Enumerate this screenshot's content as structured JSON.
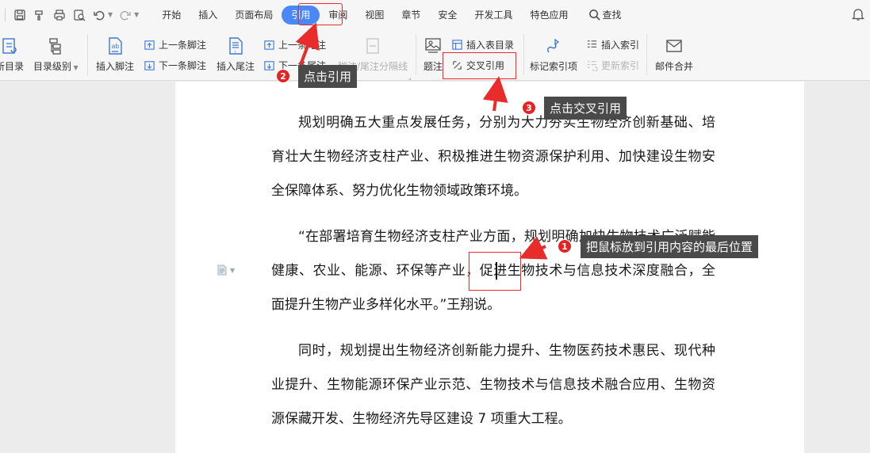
{
  "menubar": {
    "tabs": [
      {
        "label": "开始",
        "active": false
      },
      {
        "label": "插入",
        "active": false
      },
      {
        "label": "页面布局",
        "active": false
      },
      {
        "label": "引用",
        "active": true
      },
      {
        "label": "审阅",
        "active": false
      },
      {
        "label": "视图",
        "active": false
      },
      {
        "label": "章节",
        "active": false
      },
      {
        "label": "安全",
        "active": false
      },
      {
        "label": "开发工具",
        "active": false
      },
      {
        "label": "特色应用",
        "active": false
      }
    ],
    "search_label": "查找",
    "accent_color": "#4a89f5"
  },
  "ribbon": {
    "update_toc": "新目录",
    "toc_level": "目录级别",
    "insert_footnote": "插入脚注",
    "prev_footnote": "上一条脚注",
    "next_footnote": "下一条脚注",
    "insert_endnote": "插入尾注",
    "prev_endnote": "上一条尾注",
    "next_endnote": "下一条尾注",
    "separator": "脚注/尾注分隔线",
    "caption": "题注",
    "insert_table_of_figures": "插入表目录",
    "cross_reference": "交叉引用",
    "mark_index": "标记索引项",
    "insert_index": "插入索引",
    "update_index": "更新索引",
    "mail_merge": "邮件合并"
  },
  "document": {
    "paragraphs": [
      "规划明确五大重点发展任务，分别为大力夯实生物经济创新基础、培育壮大生物经济支柱产业、积极推进生物资源保护利用、加快建设生物安全保障体系、努力优化生物领域政策环境。",
      "“在部署培育生物经济支柱产业方面，规划明确加快生物技术广泛赋能健康、农业、能源、环保等产业，促进生物技术与信息技术深度融合，全面提升生物产业多样化水平。”王翔说。",
      "同时，规划提出生物经济创新能力提升、生物医药技术惠民、现代种业提升、生物能源环保产业示范、生物技术与信息技术融合应用、生物资源保藏开发、生物经济先导区建设 7 项重大工程。"
    ]
  },
  "annotations": {
    "step1": {
      "number": "1",
      "text": "把鼠标放到引用内容的最后位置"
    },
    "step2": {
      "number": "2",
      "text": "点击引用"
    },
    "step3": {
      "number": "3",
      "text": "点击交叉引用"
    },
    "highlight_color": "#e82b2b"
  }
}
